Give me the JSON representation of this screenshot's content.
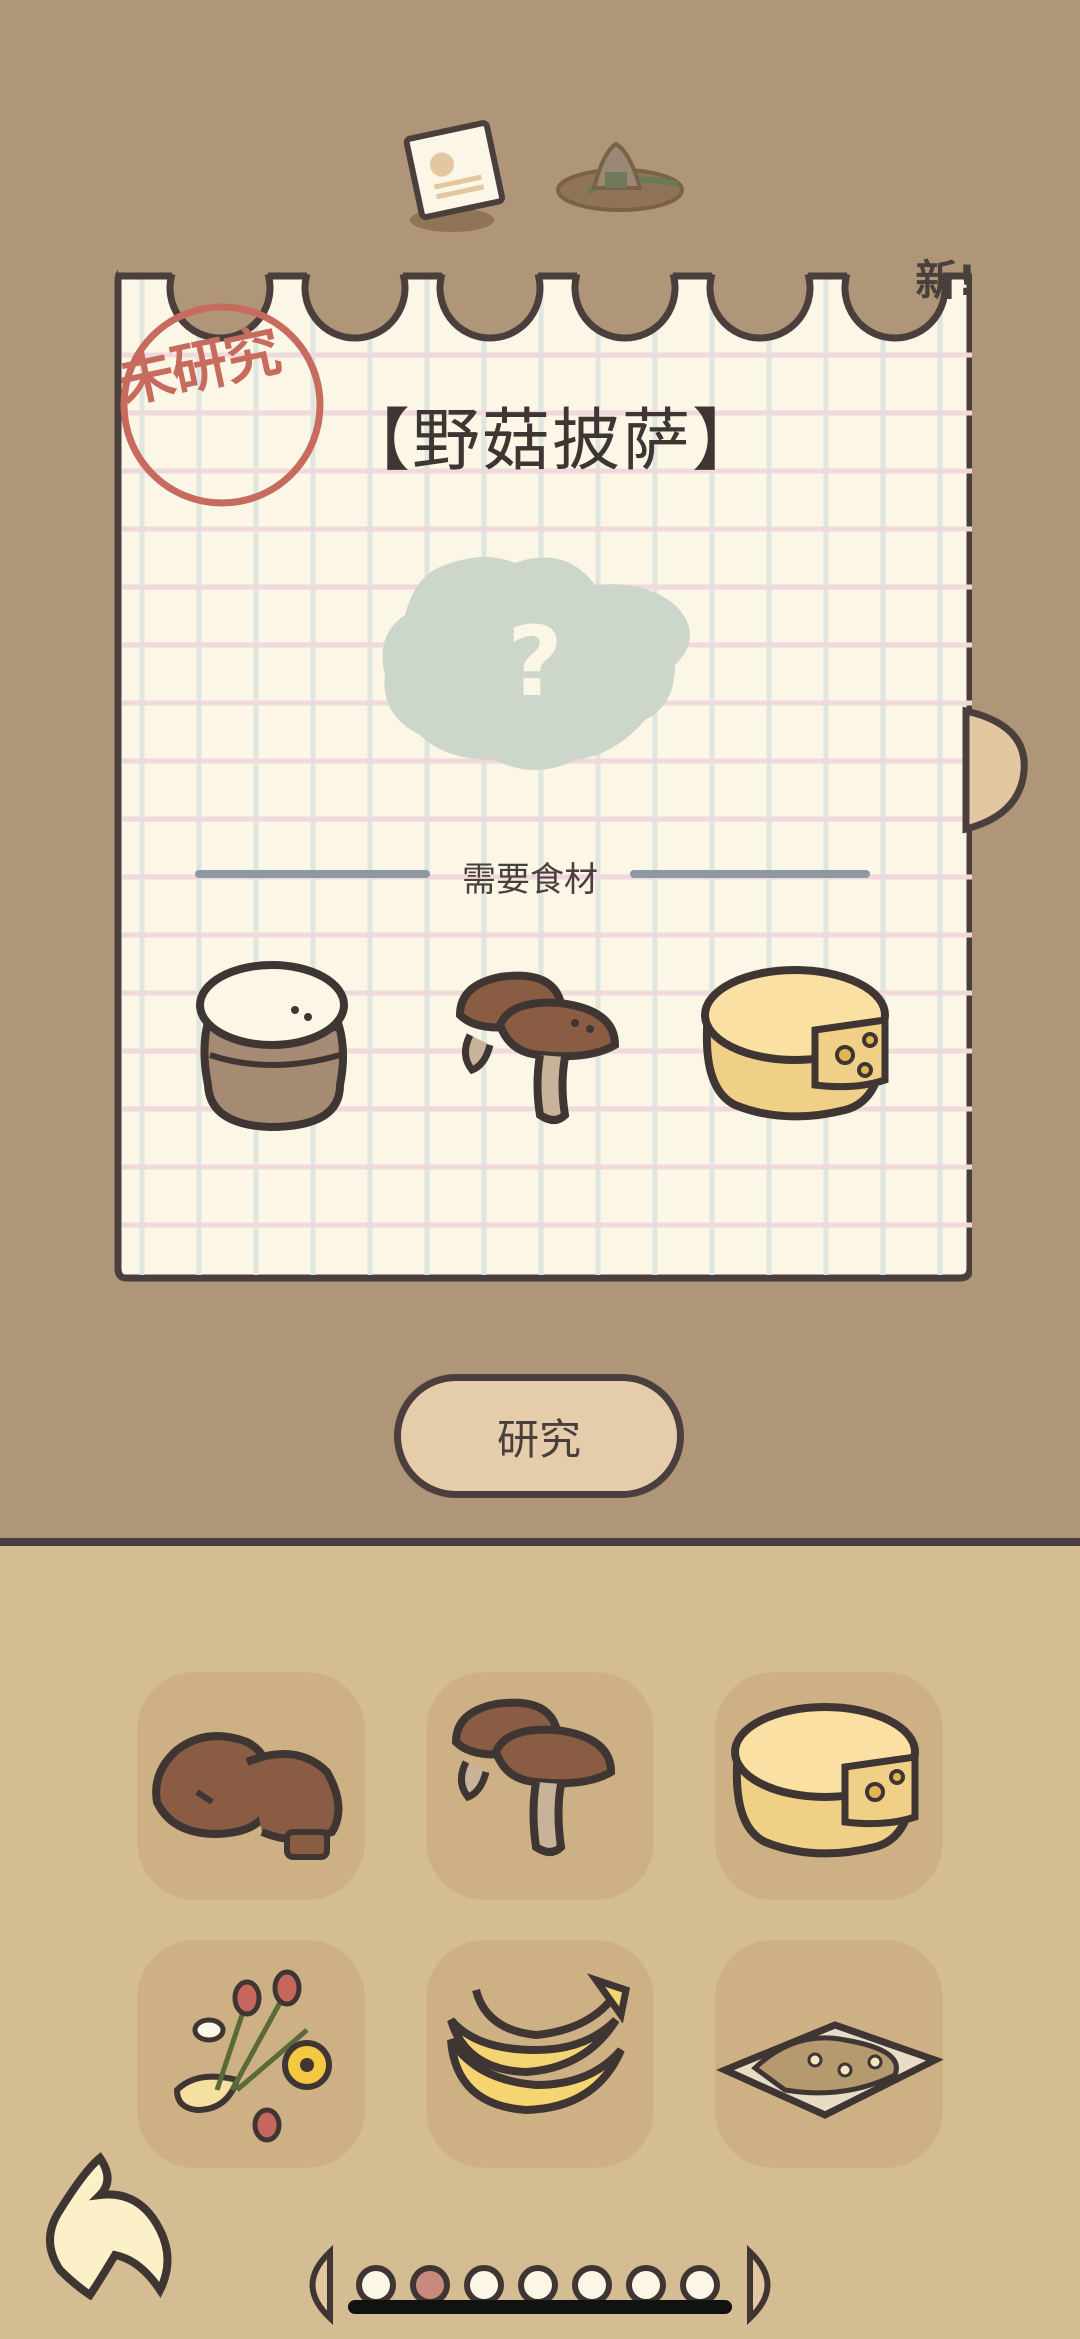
{
  "recipe": {
    "title": "【野菇披萨】",
    "stamp": "未研究",
    "new_badge": "新!",
    "mystery_mark": "?"
  },
  "ingredients_section": {
    "label": "需要食材",
    "items": [
      "flour-sack-icon",
      "mushroom-icon",
      "cheese-icon"
    ]
  },
  "actions": {
    "study_label": "研究"
  },
  "inventory": {
    "items": [
      "chocolate-icon",
      "mushroom-icon",
      "cheese-icon",
      "flower-bouquet-icon",
      "banana-icon",
      "granola-icon"
    ]
  },
  "pager": {
    "total": 7,
    "active_index": 1
  },
  "colors": {
    "background_top": "#af9679",
    "background_bottom": "#d5bd93",
    "paper": "#fbf6e6",
    "stamp": "#c76b5f",
    "outline": "#4a3f3c",
    "button": "#e5ccab"
  }
}
